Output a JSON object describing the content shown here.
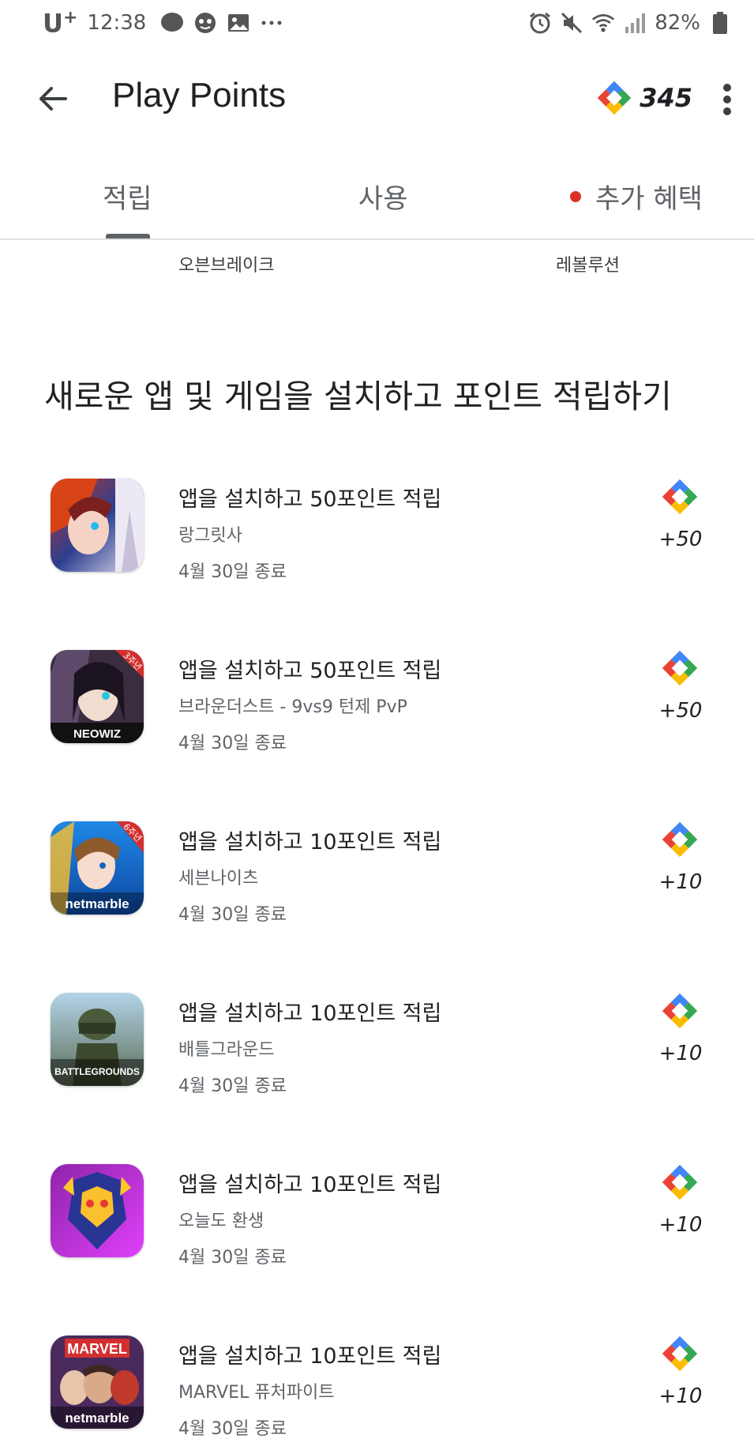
{
  "status_bar": {
    "carrier": "U",
    "carrier_plus": "+",
    "time": "12:38",
    "battery": "82%"
  },
  "header": {
    "title": "Play Points",
    "points": "345"
  },
  "tabs": [
    {
      "label": "적립",
      "selected": true
    },
    {
      "label": "사용",
      "selected": false
    },
    {
      "label": "추가 혜택",
      "selected": false
    }
  ],
  "previous_section_labels": [
    "오븐브레이크",
    "레볼루션"
  ],
  "section": {
    "title": "새로운 앱 및 게임을 설치하고 포인트 적립하기",
    "items": [
      {
        "title": "앱을 설치하고 50포인트 적립",
        "app": "랑그릿사",
        "date": "4월 30일 종료",
        "points": "+50"
      },
      {
        "title": "앱을 설치하고 50포인트 적립",
        "app": "브라운더스트 - 9vs9 턴제 PvP",
        "date": "4월 30일 종료",
        "points": "+50"
      },
      {
        "title": "앱을 설치하고 10포인트 적립",
        "app": "세븐나이츠",
        "date": "4월 30일 종료",
        "points": "+10"
      },
      {
        "title": "앱을 설치하고 10포인트 적립",
        "app": "배틀그라운드",
        "date": "4월 30일 종료",
        "points": "+10"
      },
      {
        "title": "앱을 설치하고 10포인트 적립",
        "app": "오늘도 환생",
        "date": "4월 30일 종료",
        "points": "+10"
      },
      {
        "title": "앱을 설치하고 10포인트 적립",
        "app": "MARVEL 퓨처파이트",
        "date": "4월 30일 종료",
        "points": "+10"
      }
    ]
  },
  "icon_text": {
    "neowiz": "NEOWIZ",
    "netmarble": "netmarble",
    "battlegrounds": "BATTLEGROUNDS",
    "marvel": "MARVEL",
    "anniv3": "3주년",
    "anniv6": "6주년"
  },
  "colors": {
    "tab_dot": "#d93025",
    "play_green": "#34a853",
    "play_blue": "#4285f4",
    "play_red": "#ea4335",
    "play_yellow": "#fbbc04"
  }
}
